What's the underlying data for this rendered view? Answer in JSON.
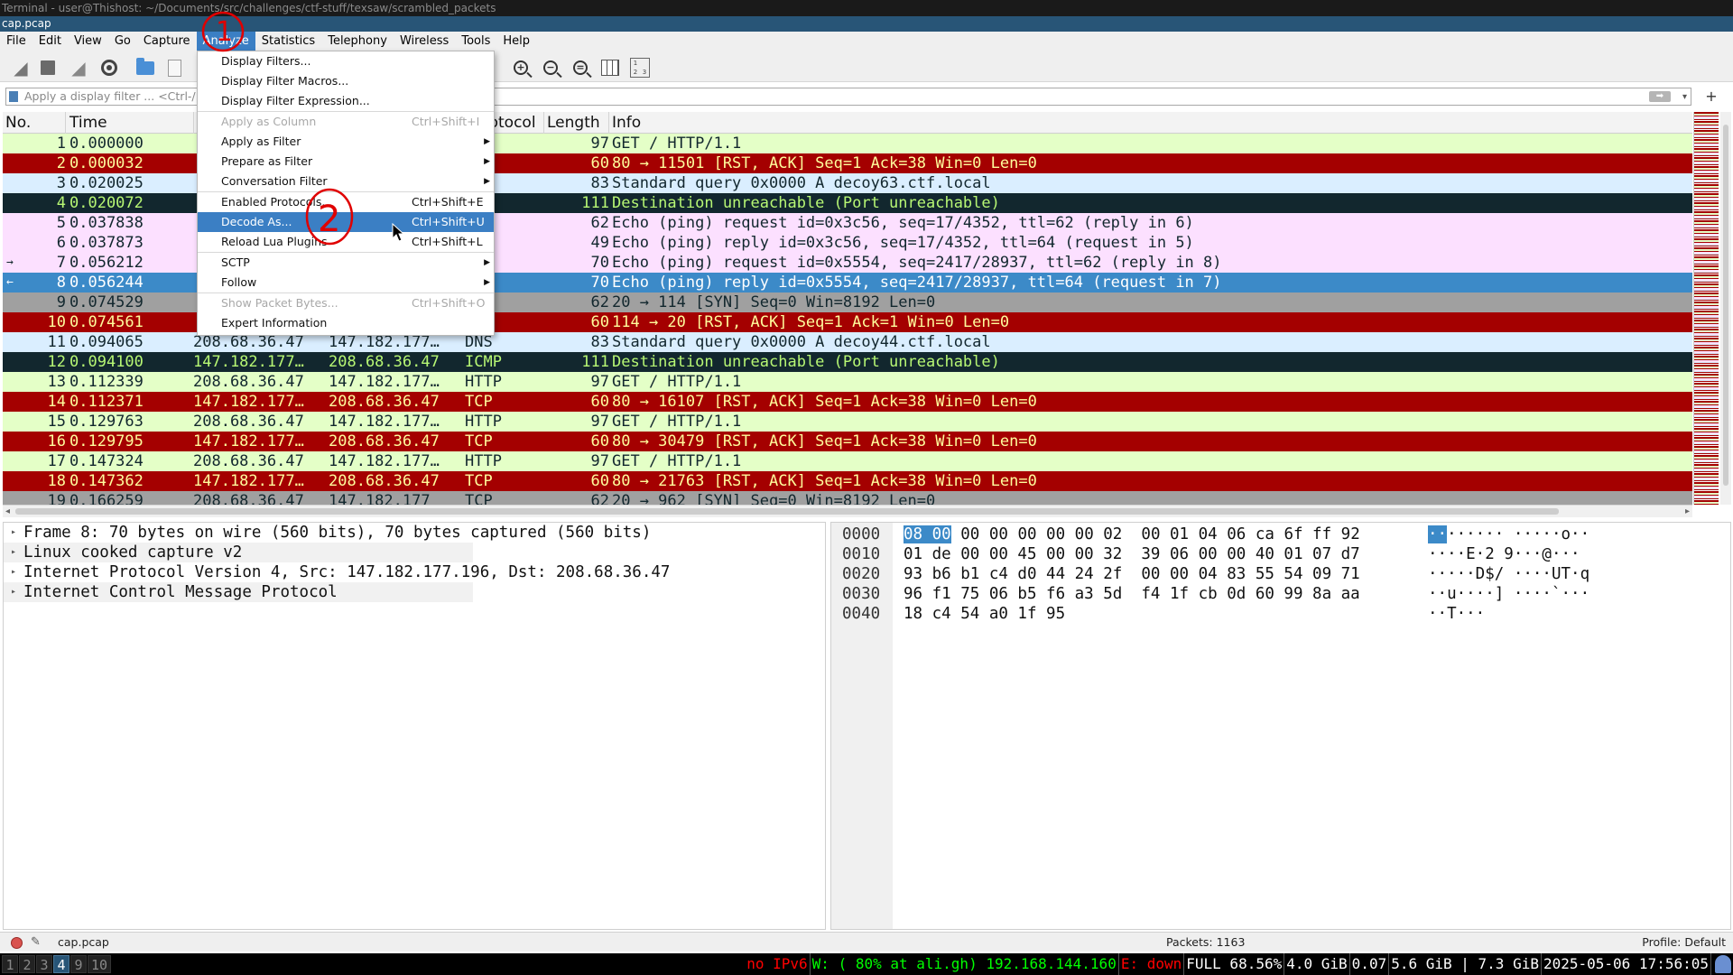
{
  "terminal_title": "Terminal - user@Thishost: ~/Documents/src/challenges/ctf-stuff/texsaw/scrambled_packets",
  "window_title": "cap.pcap",
  "menubar": [
    "File",
    "Edit",
    "View",
    "Go",
    "Capture",
    "Analyze",
    "Statistics",
    "Telephony",
    "Wireless",
    "Tools",
    "Help"
  ],
  "filter": {
    "placeholder": "Apply a display filter ... <Ctrl-/>"
  },
  "columns": [
    "No.",
    "Time",
    "S",
    "rotocol",
    "Length",
    "Info"
  ],
  "packets": [
    {
      "no": "1",
      "time": "0.000000",
      "src": "",
      "dst": "",
      "proto": "TP",
      "len": "97",
      "info": "GET / HTTP/1.1",
      "cls": "row-http"
    },
    {
      "no": "2",
      "time": "0.000032",
      "src": "",
      "dst": "",
      "proto": "",
      "len": "60",
      "info": "80 → 11501 [RST, ACK] Seq=1 Ack=38 Win=0 Len=0",
      "cls": "row-rst"
    },
    {
      "no": "3",
      "time": "0.020025",
      "src": "",
      "dst": "",
      "proto": "",
      "len": "83",
      "info": "Standard query 0x0000 A decoy63.ctf.local",
      "cls": "row-dns"
    },
    {
      "no": "4",
      "time": "0.020072",
      "src": "",
      "dst": "",
      "proto": "P",
      "len": "111",
      "info": "Destination unreachable (Port unreachable)",
      "cls": "row-icmperr"
    },
    {
      "no": "5",
      "time": "0.037838",
      "src": "",
      "dst": "",
      "proto": "P",
      "len": "62",
      "info": "Echo (ping) request  id=0x3c56, seq=17/4352, ttl=62 (reply in 6)",
      "cls": "row-icmp"
    },
    {
      "no": "6",
      "time": "0.037873",
      "src": "",
      "dst": "",
      "proto": "P",
      "len": "49",
      "info": "Echo (ping) reply    id=0x3c56, seq=17/4352, ttl=64 (request in 5)",
      "cls": "row-icmp"
    },
    {
      "no": "7",
      "time": "0.056212",
      "src": "",
      "dst": "",
      "proto": "P",
      "len": "70",
      "info": "Echo (ping) request  id=0x5554, seq=2417/28937, ttl=62 (reply in 8)",
      "cls": "row-icmp",
      "rel": "→"
    },
    {
      "no": "8",
      "time": "0.056244",
      "src": "",
      "dst": "",
      "proto": "P",
      "len": "70",
      "info": "Echo (ping) reply    id=0x5554, seq=2417/28937, ttl=64 (request in 7)",
      "cls": "row-sel",
      "rel": "←"
    },
    {
      "no": "9",
      "time": "0.074529",
      "src": "",
      "dst": "",
      "proto": "",
      "len": "62",
      "info": "20 → 114 [SYN] Seq=0 Win=8192 Len=0",
      "cls": "row-syn"
    },
    {
      "no": "10",
      "time": "0.074561",
      "src": "",
      "dst": "",
      "proto": "",
      "len": "60",
      "info": "114 → 20 [RST, ACK] Seq=1 Ack=1 Win=0 Len=0",
      "cls": "row-rst"
    },
    {
      "no": "11",
      "time": "0.094065",
      "src": "208.68.36.47",
      "dst": "147.182.177…",
      "proto": "DNS",
      "len": "83",
      "info": "Standard query 0x0000 A decoy44.ctf.local",
      "cls": "row-dns"
    },
    {
      "no": "12",
      "time": "0.094100",
      "src": "147.182.177…",
      "dst": "208.68.36.47",
      "proto": "ICMP",
      "len": "111",
      "info": "Destination unreachable (Port unreachable)",
      "cls": "row-icmperr"
    },
    {
      "no": "13",
      "time": "0.112339",
      "src": "208.68.36.47",
      "dst": "147.182.177…",
      "proto": "HTTP",
      "len": "97",
      "info": "GET / HTTP/1.1",
      "cls": "row-http"
    },
    {
      "no": "14",
      "time": "0.112371",
      "src": "147.182.177…",
      "dst": "208.68.36.47",
      "proto": "TCP",
      "len": "60",
      "info": "80 → 16107 [RST, ACK] Seq=1 Ack=38 Win=0 Len=0",
      "cls": "row-rst"
    },
    {
      "no": "15",
      "time": "0.129763",
      "src": "208.68.36.47",
      "dst": "147.182.177…",
      "proto": "HTTP",
      "len": "97",
      "info": "GET / HTTP/1.1",
      "cls": "row-http"
    },
    {
      "no": "16",
      "time": "0.129795",
      "src": "147.182.177…",
      "dst": "208.68.36.47",
      "proto": "TCP",
      "len": "60",
      "info": "80 → 30479 [RST, ACK] Seq=1 Ack=38 Win=0 Len=0",
      "cls": "row-rst"
    },
    {
      "no": "17",
      "time": "0.147324",
      "src": "208.68.36.47",
      "dst": "147.182.177…",
      "proto": "HTTP",
      "len": "97",
      "info": "GET / HTTP/1.1",
      "cls": "row-http"
    },
    {
      "no": "18",
      "time": "0.147362",
      "src": "147.182.177…",
      "dst": "208.68.36.47",
      "proto": "TCP",
      "len": "60",
      "info": "80 → 21763 [RST, ACK] Seq=1 Ack=38 Win=0 Len=0",
      "cls": "row-rst"
    },
    {
      "no": "19",
      "time": "0.166259",
      "src": "208.68.36.47",
      "dst": "147.182.177",
      "proto": "TCP",
      "len": "62",
      "info": "20 → 962 [SYN] Seq=0 Win=8192 Len=0",
      "cls": "row-syn"
    }
  ],
  "details": [
    "Frame 8: 70 bytes on wire (560 bits), 70 bytes captured (560 bits)",
    "Linux cooked capture v2",
    "Internet Protocol Version 4, Src: 147.182.177.196, Dst: 208.68.36.47",
    "Internet Control Message Protocol"
  ],
  "bytes": [
    {
      "off": "0000",
      "hex_sel": "08 00",
      "hex": " 00 00 00 00 00 02  00 01 04 06 ca 6f ff 92",
      "asc_sel": "··",
      "asc": "······ ·····o··"
    },
    {
      "off": "0010",
      "hex_sel": "",
      "hex": "01 de 00 00 45 00 00 32  39 06 00 00 40 01 07 d7",
      "asc_sel": "",
      "asc": "····E·2 9···@···"
    },
    {
      "off": "0020",
      "hex_sel": "",
      "hex": "93 b6 b1 c4 d0 44 24 2f  00 00 04 83 55 54 09 71",
      "asc_sel": "",
      "asc": "·····D$/ ····UT·q"
    },
    {
      "off": "0030",
      "hex_sel": "",
      "hex": "96 f1 75 06 b5 f6 a3 5d  f4 1f cb 0d 60 99 8a aa",
      "asc_sel": "",
      "asc": "··u····] ····`···"
    },
    {
      "off": "0040",
      "hex_sel": "",
      "hex": "18 c4 54 a0 1f 95",
      "asc_sel": "",
      "asc": "··T···"
    }
  ],
  "analyze_menu": [
    {
      "label": "Display Filters...",
      "shortcut": "",
      "sub": false,
      "disabled": false
    },
    {
      "label": "Display Filter Macros...",
      "shortcut": "",
      "sub": false,
      "disabled": false
    },
    {
      "label": "Display Filter Expression...",
      "shortcut": "",
      "sub": false,
      "disabled": false
    },
    {
      "sep": true
    },
    {
      "label": "Apply as Column",
      "shortcut": "Ctrl+Shift+I",
      "sub": false,
      "disabled": true
    },
    {
      "label": "Apply as Filter",
      "shortcut": "",
      "sub": true,
      "disabled": false
    },
    {
      "label": "Prepare as Filter",
      "shortcut": "",
      "sub": true,
      "disabled": false
    },
    {
      "label": "Conversation Filter",
      "shortcut": "",
      "sub": true,
      "disabled": false
    },
    {
      "sep": true
    },
    {
      "label": "Enabled Protocols...",
      "shortcut": "Ctrl+Shift+E",
      "sub": false,
      "disabled": false
    },
    {
      "label": "Decode As...",
      "shortcut": "Ctrl+Shift+U",
      "sub": false,
      "disabled": false,
      "highlight": true
    },
    {
      "label": "Reload Lua Plugins",
      "shortcut": "Ctrl+Shift+L",
      "sub": false,
      "disabled": false
    },
    {
      "sep": true
    },
    {
      "label": "SCTP",
      "shortcut": "",
      "sub": true,
      "disabled": false
    },
    {
      "label": "Follow",
      "shortcut": "",
      "sub": true,
      "disabled": false
    },
    {
      "sep": true
    },
    {
      "label": "Show Packet Bytes...",
      "shortcut": "Ctrl+Shift+O",
      "sub": false,
      "disabled": true
    },
    {
      "label": "Expert Information",
      "shortcut": "",
      "sub": false,
      "disabled": false
    }
  ],
  "status": {
    "file": "cap.pcap",
    "packets": "Packets: 1163",
    "profile": "Profile: Default"
  },
  "workspaces": [
    "1",
    "2",
    "3",
    "4",
    "9",
    "10"
  ],
  "i3status": [
    {
      "text": "no IPv6",
      "color": "red"
    },
    {
      "text": "W: ( 80% at ali.gh) 192.168.144.160",
      "color": "green"
    },
    {
      "text": "E: down",
      "color": "red"
    },
    {
      "text": "FULL 68.56%",
      "color": "white"
    },
    {
      "text": "4.0 GiB",
      "color": "white"
    },
    {
      "text": "0.07",
      "color": "white"
    },
    {
      "text": "5.6 GiB | 7.3 GiB",
      "color": "white"
    },
    {
      "text": "2025-05-06 17:56:05",
      "color": "white"
    }
  ],
  "annotations": [
    "1",
    "2"
  ]
}
